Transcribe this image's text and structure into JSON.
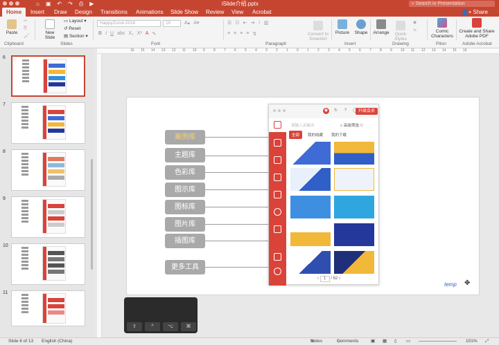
{
  "app": {
    "title": "iSlide介绍.pptx",
    "search_placeholder": "Search in Presentation",
    "share_label": "Share",
    "accent_color": "#c64531"
  },
  "quick_access": [
    "home-icon",
    "save-icon",
    "undo-icon",
    "redo-icon",
    "print-icon",
    "play-icon"
  ],
  "tabs": [
    "Home",
    "Insert",
    "Draw",
    "Design",
    "Transitions",
    "Animations",
    "Slide Show",
    "Review",
    "View",
    "Acrobat"
  ],
  "ribbon": {
    "paste": "Paste",
    "clipboard": "Clipboard",
    "new_slide": "New Slide",
    "layout": "Layout",
    "reset": "Reset",
    "section": "Section",
    "slides": "Slides",
    "font_name": "HappyZcool-2016",
    "font_size": "10",
    "font": "Font",
    "paragraph": "Paragraph",
    "convert_smartart": "Convert to SmartArt",
    "picture": "Picture",
    "shape": "Shape",
    "insert": "Insert",
    "arrange": "Arrange",
    "quick_styles": "Quick Styles",
    "drawing": "Drawing",
    "comic_characters": "Comic Characters",
    "piton": "Piton",
    "create_share_pdf": "Create and Share Adobe PDF",
    "adobe_acrobat": "Adobe Acrobat"
  },
  "ruler_marks": [
    "16",
    "15",
    "14",
    "13",
    "12",
    "11",
    "10",
    "9",
    "8",
    "7",
    "6",
    "5",
    "4",
    "3",
    "2",
    "1",
    "0",
    "1",
    "2",
    "3",
    "4",
    "5",
    "6",
    "7",
    "8",
    "9",
    "10",
    "11",
    "12",
    "13",
    "14",
    "15",
    "16"
  ],
  "thumbnails": [
    {
      "num": "6",
      "selected": true
    },
    {
      "num": "7",
      "selected": false
    },
    {
      "num": "8",
      "selected": false
    },
    {
      "num": "9",
      "selected": false
    },
    {
      "num": "10",
      "selected": false
    },
    {
      "num": "11",
      "selected": false
    }
  ],
  "slide": {
    "menu": [
      "案例库",
      "主题库",
      "色彩库",
      "图示库",
      "图标库",
      "图片库",
      "插图库"
    ],
    "more_tools": "更多工具",
    "highlight_color": "#f6d26a",
    "watermark": "temp",
    "panel": {
      "upgrade": "升级会员",
      "search_placeholder": "请输入关键词",
      "filter": "高级筛选",
      "tabs": [
        "全部",
        "我的收藏",
        "我的下载"
      ],
      "page_current": "1",
      "page_total": "/ 62",
      "red": "#d9433a"
    }
  },
  "touchbar_keys": [
    "⇧",
    "^",
    "⌥",
    "⌘"
  ],
  "status": {
    "slide_info": "Slide 6 of 13",
    "language": "English (China)",
    "notes": "Notes",
    "comments": "Comments",
    "zoom": "101%"
  }
}
